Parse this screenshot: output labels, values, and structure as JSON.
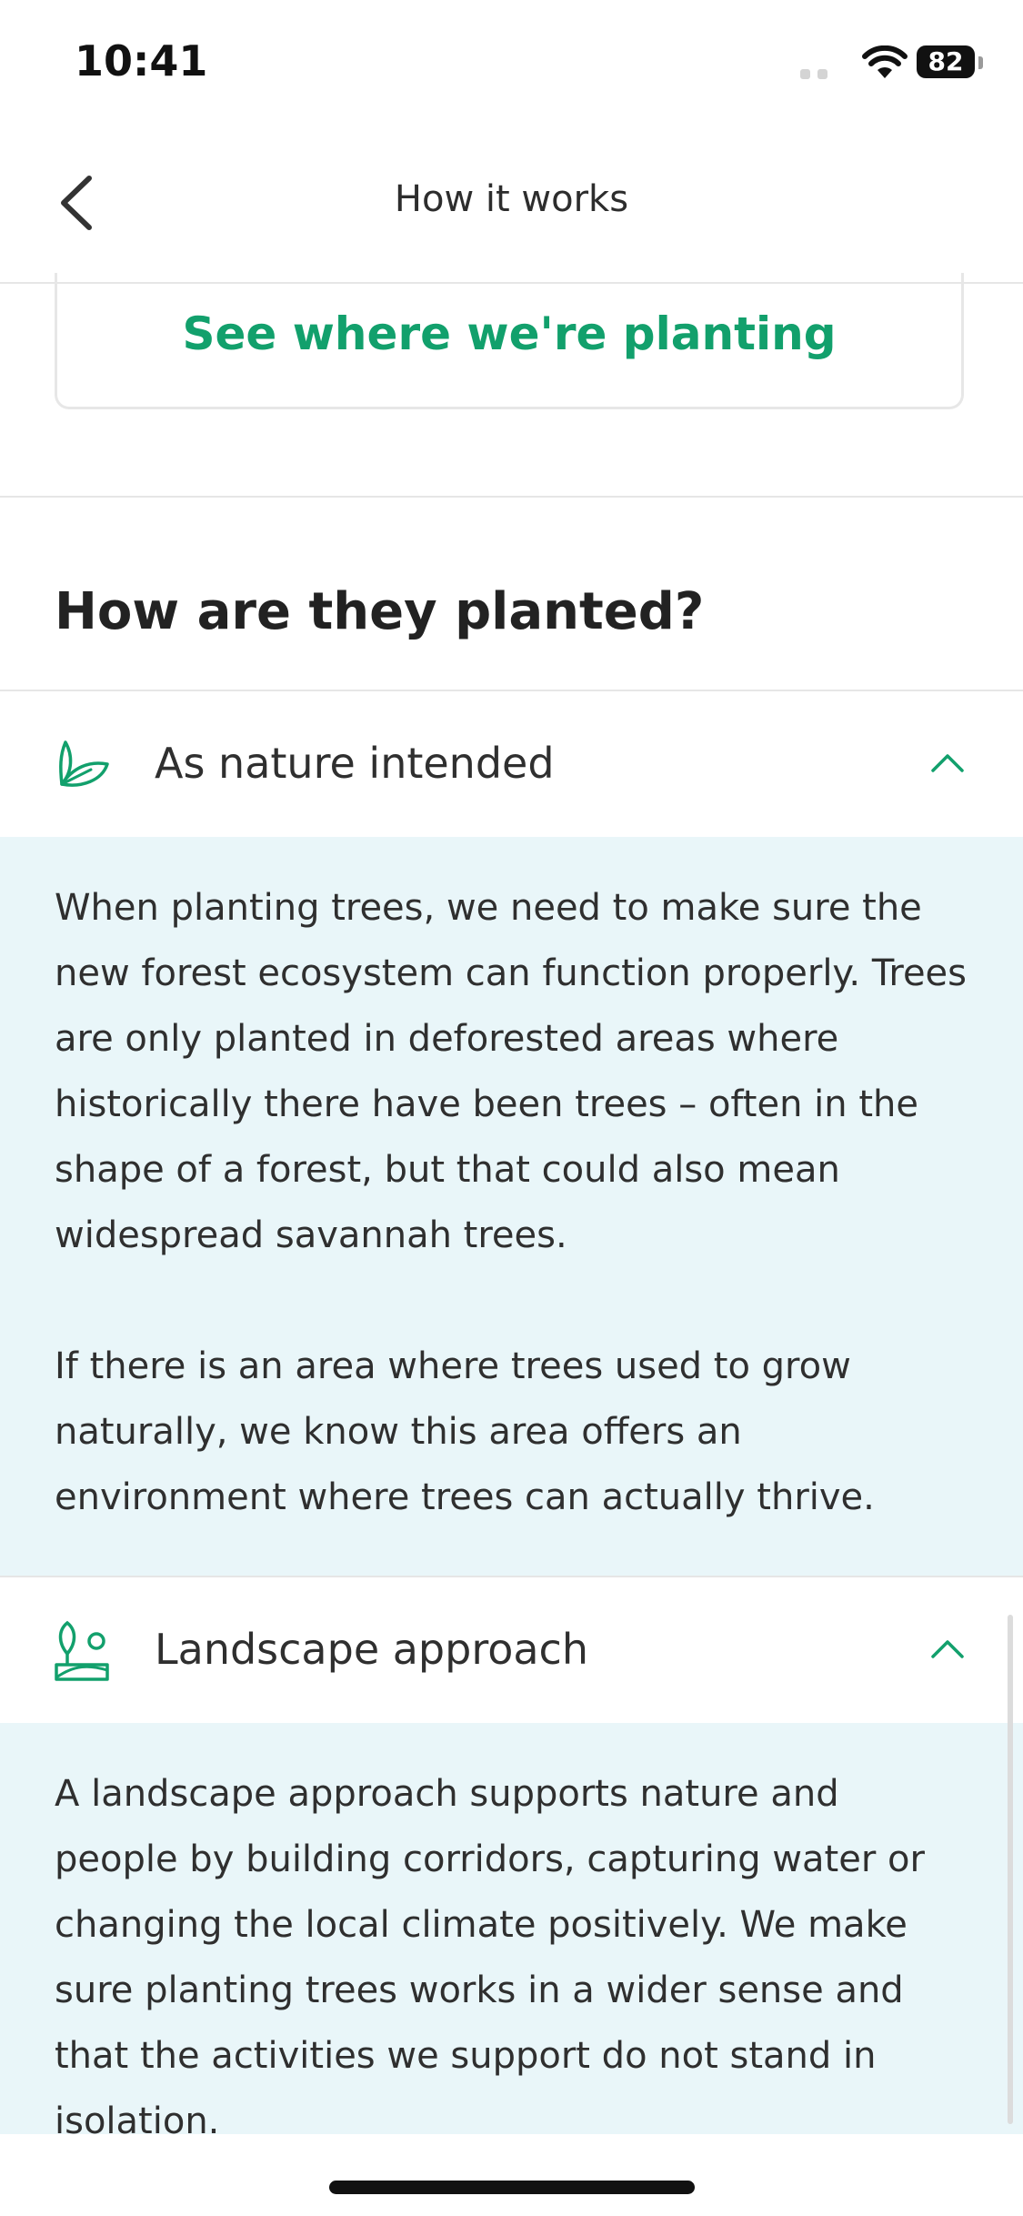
{
  "status_bar": {
    "time": "10:41",
    "battery": "82"
  },
  "header": {
    "title": "How it works",
    "back_icon": "chevron-left-icon"
  },
  "planting_link": {
    "label": "See where we're planting"
  },
  "section": {
    "title": "How are they planted?"
  },
  "accordions": [
    {
      "title": "As nature intended",
      "icon": "leaf-icon",
      "expanded": true,
      "paragraphs": [
        "When planting trees, we need to make sure the new forest ecosystem can function properly. Trees are only planted in deforested areas where historically there have been trees – often in the shape of a forest, but that could also mean widespread savannah trees.",
        "If there is an area where trees used to grow naturally, we know this area offers an environment where trees can actually thrive."
      ]
    },
    {
      "title": "Landscape approach",
      "icon": "landscape-icon",
      "expanded": true,
      "paragraphs": [
        "A landscape approach supports nature and people by building corridors, capturing water or changing the local climate positively. We make sure planting trees works in a wider sense and that the activities we support do not stand in isolation."
      ]
    }
  ],
  "colors": {
    "accent": "#12a06c",
    "panel_bg": "#e9f6f9",
    "divider": "#e6e6e6"
  }
}
